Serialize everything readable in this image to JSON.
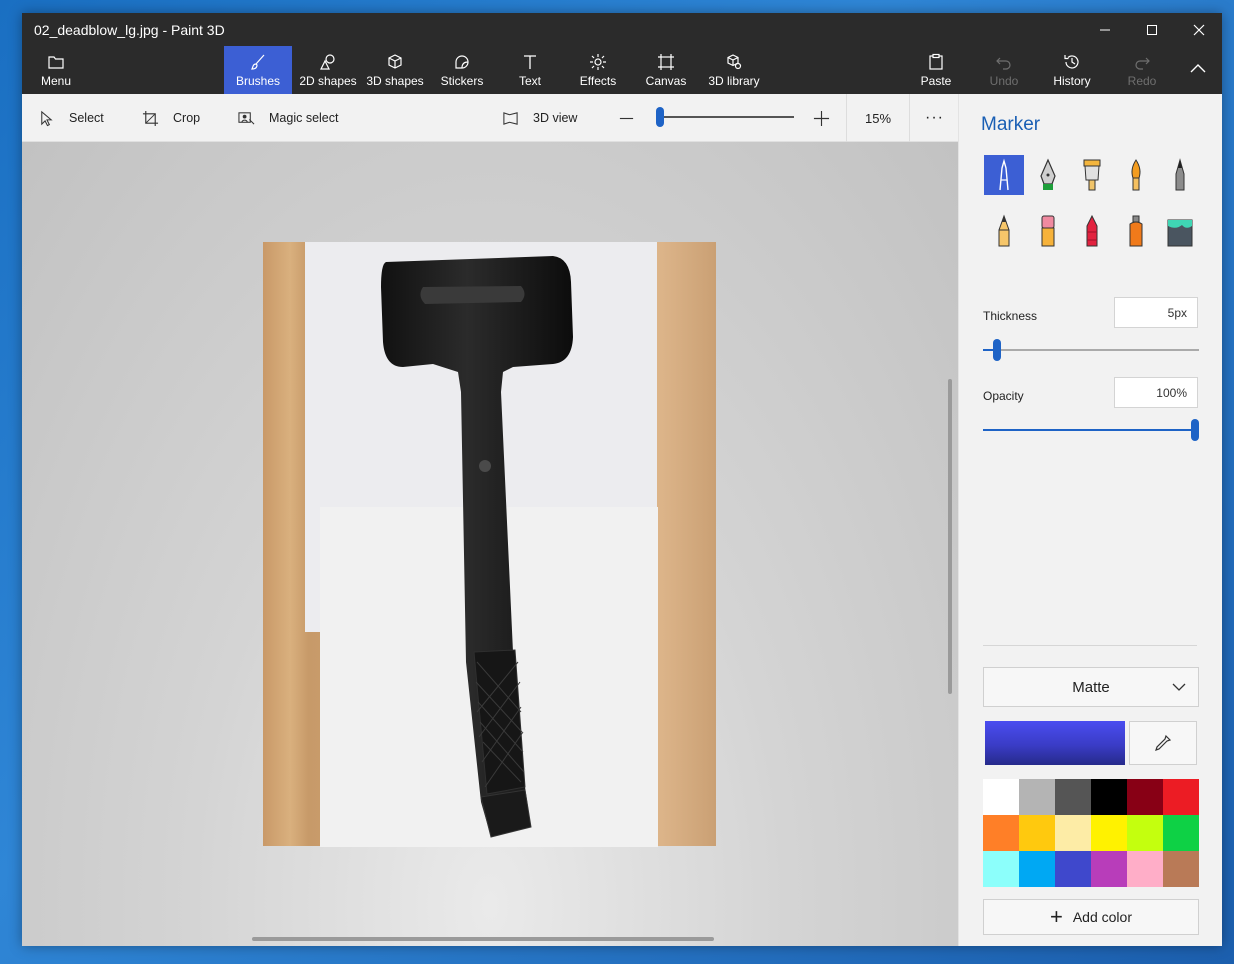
{
  "window": {
    "title": "02_deadblow_lg.jpg - Paint 3D"
  },
  "ribbon": {
    "menu": "Menu",
    "tools": [
      "Brushes",
      "2D shapes",
      "3D shapes",
      "Stickers",
      "Text",
      "Effects",
      "Canvas",
      "3D library"
    ],
    "active_tool": "Brushes",
    "actions": [
      "Paste",
      "Undo",
      "History",
      "Redo"
    ],
    "disabled_actions": [
      "Undo",
      "Redo"
    ]
  },
  "toolbar": {
    "select": "Select",
    "crop": "Crop",
    "magic_select": "Magic select",
    "view_3d": "3D view",
    "zoom": "15%",
    "more": "···"
  },
  "panel": {
    "title": "Marker",
    "brushes": [
      "marker-icon",
      "calligraphy-pen-icon",
      "oil-brush-icon",
      "watercolor-icon",
      "pixel-pen-icon",
      "pencil-icon",
      "eraser-icon",
      "crayon-icon",
      "spray-can-icon",
      "fill-bucket-icon"
    ],
    "selected_brush": "marker-icon",
    "thickness_label": "Thickness",
    "thickness_value": "5px",
    "thickness_level": 0.05,
    "opacity_label": "Opacity",
    "opacity_value": "100%",
    "opacity_level": 1.0,
    "finish": "Matte",
    "current_color": "#3b3ed0",
    "palette": [
      "#ffffff",
      "#b4b4b4",
      "#555555",
      "#000000",
      "#880015",
      "#ec1c24",
      "#ff7f27",
      "#ffc90e",
      "#fdeca6",
      "#fff200",
      "#c4ff0e",
      "#0ed145",
      "#8cfffb",
      "#00a8f3",
      "#3f48cc",
      "#b83dba",
      "#ffaec8",
      "#b97a57"
    ],
    "add_color": "Add color"
  },
  "colors": {
    "accent": "#3c5fd4",
    "titlebar": "#2b2b2b",
    "link": "#1a5fb4"
  }
}
